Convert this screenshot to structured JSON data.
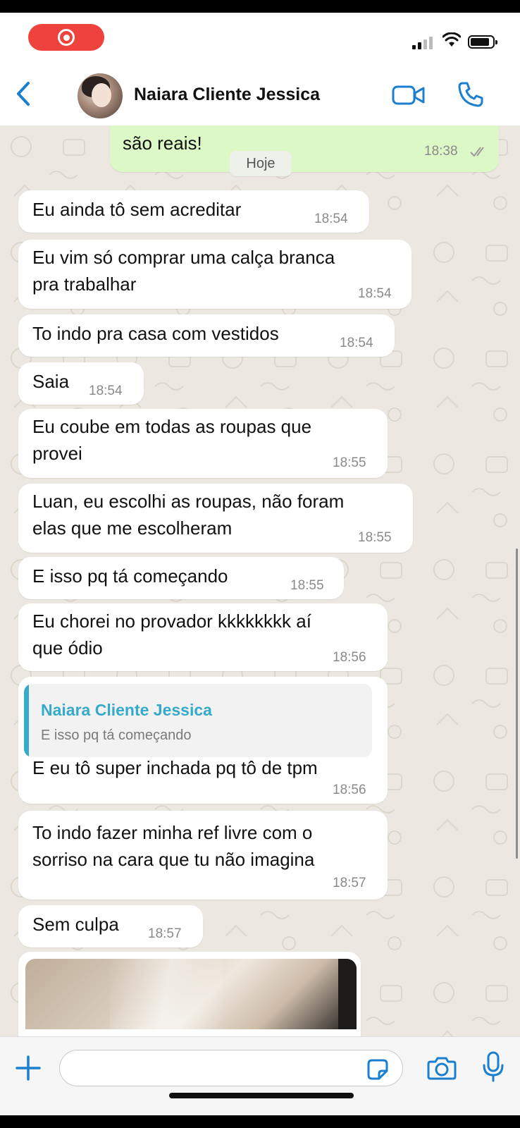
{
  "status_bar": {
    "recording_icon": "screen-recording-icon",
    "signal_icon": "cellular-signal-icon",
    "wifi_icon": "wifi-icon",
    "battery_icon": "battery-icon"
  },
  "header": {
    "contact_name": "Naiara Cliente Jessica",
    "back_icon": "chevron-left-icon",
    "video_icon": "video-call-icon",
    "call_icon": "phone-icon",
    "accent_color": "#1b7fcf"
  },
  "chat": {
    "date_chip": "Hoje",
    "outgoing": {
      "text": "são reais!",
      "time": "18:38",
      "status_icon": "read-ticks-icon"
    },
    "messages": [
      {
        "lines": [
          "Eu ainda tô sem acreditar"
        ],
        "time": "18:54"
      },
      {
        "lines": [
          "Eu vim só comprar uma calça branca",
          "pra trabalhar"
        ],
        "time": "18:54"
      },
      {
        "lines": [
          "To indo pra casa com vestidos"
        ],
        "time": "18:54"
      },
      {
        "lines": [
          "Saia"
        ],
        "time": "18:54"
      },
      {
        "lines": [
          "Eu coube em todas as roupas que",
          "provei"
        ],
        "time": "18:55"
      },
      {
        "lines": [
          "Luan, eu escolhi as roupas, não foram",
          "elas que me escolheram"
        ],
        "time": "18:55"
      },
      {
        "lines": [
          "E isso pq tá começando"
        ],
        "time": "18:55"
      },
      {
        "lines": [
          "Eu chorei no provador kkkkkkkk aí",
          "que ódio"
        ],
        "time": "18:56"
      }
    ],
    "reply": {
      "quoted_name": "Naiara Cliente Jessica",
      "quoted_text": "E isso pq tá começando",
      "text": "E eu tô super inchada pq tô de tpm",
      "time": "18:56"
    },
    "messages_after": [
      {
        "lines": [
          "To indo fazer minha ref livre com o",
          "sorriso na cara que tu não imagina"
        ],
        "time": "18:57"
      },
      {
        "lines": [
          "Sem culpa"
        ],
        "time": "18:57"
      }
    ],
    "photo": "image-message-thumbnail"
  },
  "composer": {
    "placeholder": "",
    "plus_icon": "plus-icon",
    "sticker_icon": "sticker-icon",
    "camera_icon": "camera-icon",
    "mic_icon": "microphone-icon"
  }
}
